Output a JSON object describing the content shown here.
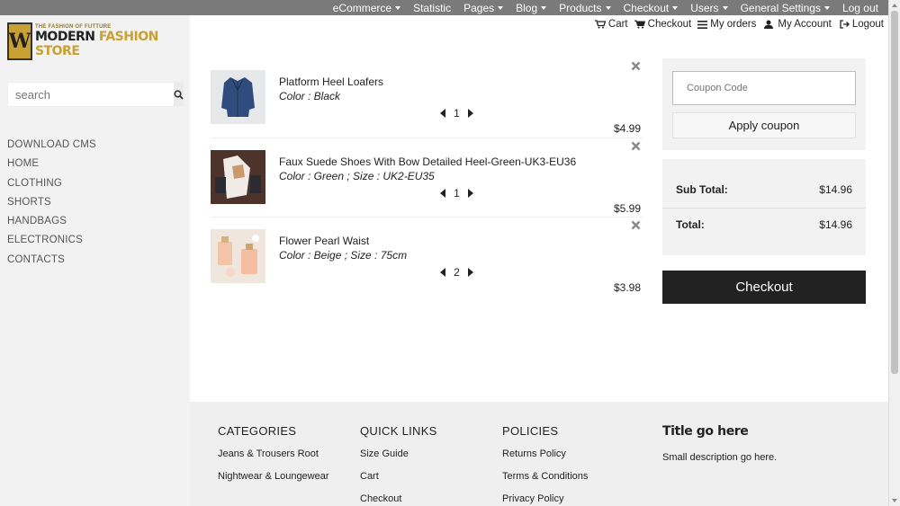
{
  "topbar": {
    "items": [
      {
        "label": "eCommerce",
        "dropdown": true
      },
      {
        "label": "Statistic",
        "dropdown": false
      },
      {
        "label": "Pages",
        "dropdown": true
      },
      {
        "label": "Blog",
        "dropdown": true
      },
      {
        "label": "Products",
        "dropdown": true
      },
      {
        "label": "Checkout",
        "dropdown": true
      },
      {
        "label": "Users",
        "dropdown": true
      },
      {
        "label": "General Settings",
        "dropdown": true
      },
      {
        "label": "Log out",
        "dropdown": false
      }
    ]
  },
  "logo": {
    "tagline": "THE FASHION OF FUTTURE",
    "name_part1": "MODERN ",
    "name_part2": "FASHION STORE",
    "badge": "W"
  },
  "search": {
    "placeholder": "search"
  },
  "sidebar": {
    "items": [
      "DOWNLOAD CMS",
      "HOME",
      "CLOTHING",
      "SHORTS",
      "HANDBAGS",
      "ELECTRONICS",
      "CONTACTS"
    ]
  },
  "header": {
    "cart": "Cart",
    "checkout": "Checkout",
    "orders": "My orders",
    "account": "My Account",
    "logout": "Logout"
  },
  "cart": {
    "items": [
      {
        "name": "Platform Heel Loafers",
        "attrs": "Color : Black",
        "qty": "1",
        "price": "$4.99"
      },
      {
        "name": "Faux Suede Shoes With Bow Detailed Heel-Green-UK3-EU36",
        "attrs": "Color : Green ; Size : UK2-EU35",
        "qty": "1",
        "price": "$5.99"
      },
      {
        "name": "Flower Pearl Waist",
        "attrs": "Color : Beige ; Size : 75cm",
        "qty": "2",
        "price": "$3.98"
      }
    ]
  },
  "coupon": {
    "placeholder": "Coupon Code",
    "button": "Apply coupon"
  },
  "totals": {
    "subtotal_label": "Sub Total:",
    "subtotal": "$14.96",
    "total_label": "Total:",
    "total": "$14.96"
  },
  "checkout_button": "Checkout",
  "footer": {
    "categories": {
      "heading": "CATEGORIES",
      "links": [
        "Jeans & Trousers Root",
        "Nightwear & Loungewear"
      ]
    },
    "quick_links": {
      "heading": "QUICK LINKS",
      "links": [
        "Size Guide",
        "Cart",
        "Checkout"
      ]
    },
    "policies": {
      "heading": "POLICIES",
      "links": [
        "Returns Policy",
        "Terms & Conditions",
        "Privacy Policy"
      ]
    },
    "info": {
      "title": "Title go here",
      "desc": "Small description go here."
    }
  },
  "colors": {
    "topbar": "#7a7a7a",
    "sidebar": "#f2f2f2",
    "accent_gold": "#c9a032",
    "checkout_btn": "#222222"
  }
}
